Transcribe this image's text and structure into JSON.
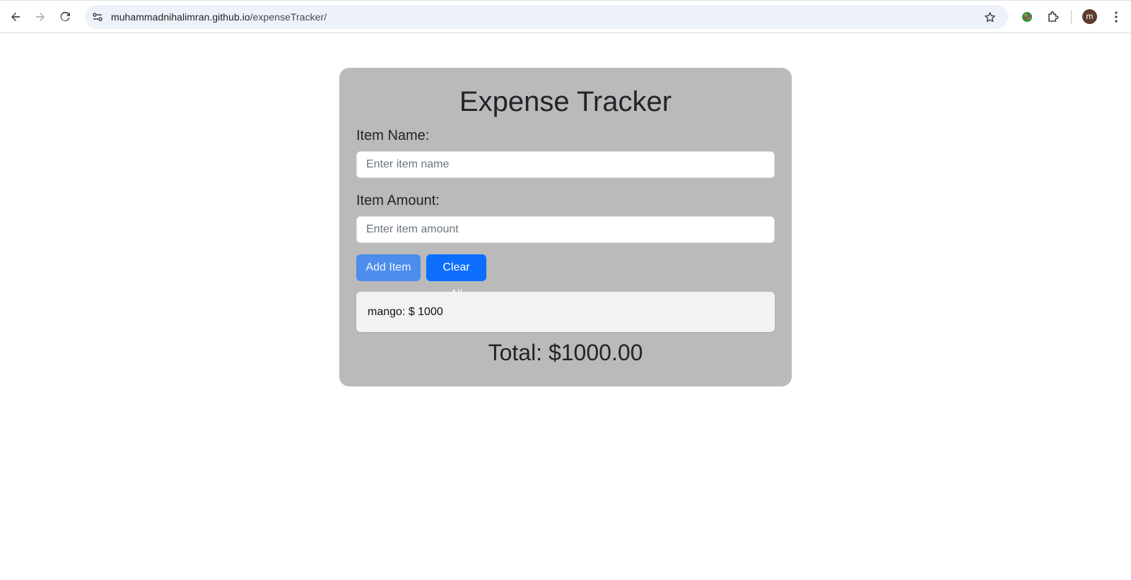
{
  "browser": {
    "url_host": "muhammadnihalimran.github.io",
    "url_path": "/expenseTracker/",
    "profile_initial": "m",
    "icons": {
      "back": "back-arrow-icon",
      "forward": "forward-arrow-icon",
      "reload": "reload-icon",
      "site_info": "site-info-icon",
      "bookmark": "star-icon",
      "extension_app": "extension-app-icon",
      "extensions": "puzzle-icon",
      "menu": "kebab-menu-icon"
    }
  },
  "app": {
    "title": "Expense Tracker",
    "item_name_label": "Item Name:",
    "item_name_placeholder": "Enter item name",
    "item_amount_label": "Item Amount:",
    "item_amount_placeholder": "Enter item amount",
    "add_button": "Add Item",
    "clear_button": "Clear All",
    "items": [
      {
        "text": "mango: $ 1000"
      }
    ],
    "total": "Total: $1000.00"
  },
  "colors": {
    "card_background": "#bababa",
    "primary_button": "#0d6efd",
    "add_button": "#4c8ded",
    "list_background": "#f1f2f4"
  }
}
